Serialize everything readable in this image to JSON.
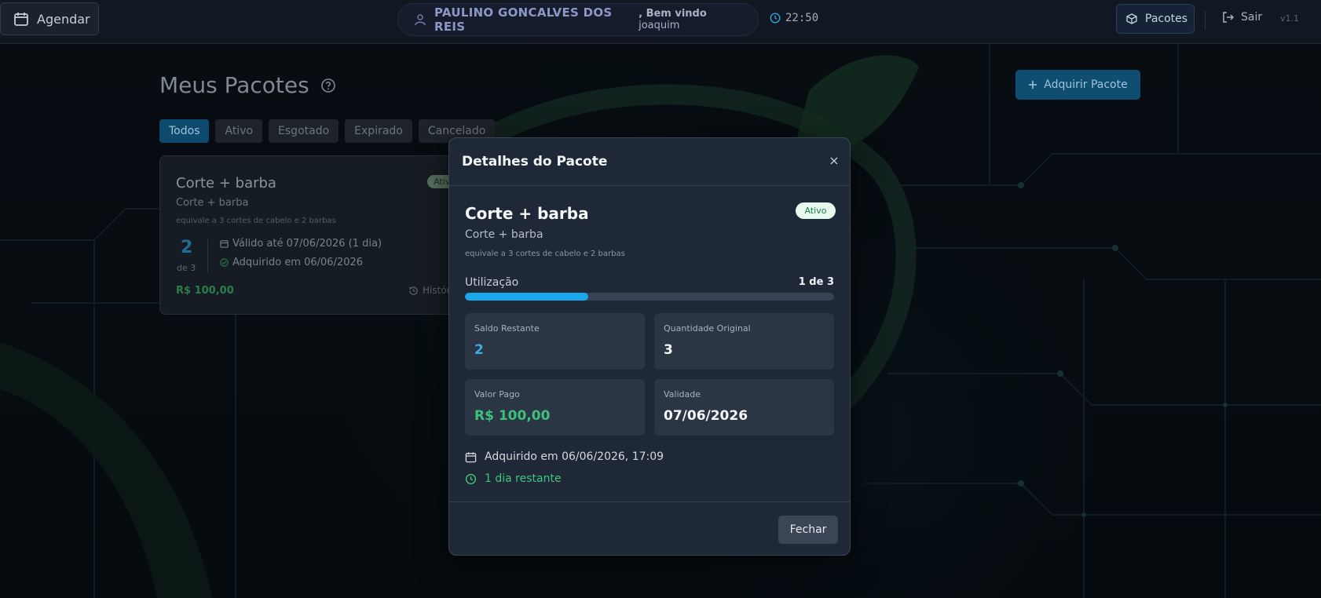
{
  "navbar": {
    "agendar_label": "Agendar",
    "user_name": "PAULINO GONCALVES DOS REIS",
    "welcome_prefix": ", Bem vindo",
    "welcome_user": "joaquim",
    "clock": "22:50",
    "pacotes_label": "Pacotes",
    "logout_label": "Sair",
    "version": "v1.1"
  },
  "page": {
    "title": "Meus Pacotes",
    "add_button": "Adquirir Pacote",
    "filters": [
      "Todos",
      "Ativo",
      "Esgotado",
      "Expirado",
      "Cancelado"
    ],
    "active_filter": "Todos"
  },
  "card": {
    "title": "Corte + barba",
    "subtitle": "Corte + barba",
    "description": "equivale a 3 cortes de cabelo e 2 barbas",
    "badge": "Ativo",
    "remaining": "2",
    "of_total": "de 3",
    "valid_until": "Válido até 07/06/2026 (1 dia)",
    "acquired": "Adquirido em 06/06/2026",
    "price": "R$ 100,00",
    "history_label": "Histórico"
  },
  "modal": {
    "title": "Detalhes do Pacote",
    "close_symbol": "×",
    "package_name": "Corte + barba",
    "status": "Ativo",
    "subtitle": "Corte + barba",
    "description": "equivale a 3 cortes de cabelo e 2 barbas",
    "usage_label": "Utilização",
    "usage_value": "1 de 3",
    "usage_fraction": 0.3333,
    "boxes": {
      "saldo_label": "Saldo Restante",
      "saldo_value": "2",
      "original_label": "Quantidade Original",
      "original_value": "3",
      "pago_label": "Valor Pago",
      "pago_value": "R$ 100,00",
      "validade_label": "Validade",
      "validade_value": "07/06/2026"
    },
    "acquired_line": "Adquirido em 06/06/2026, 17:09",
    "remaining_line": "1 dia restante",
    "close_button": "Fechar"
  },
  "colors": {
    "accent": "#1aa7ea",
    "success": "#40c57f",
    "modal_bg": "#1e2837"
  },
  "icons": [
    "calendar-icon",
    "user-icon",
    "clock-icon",
    "box-icon",
    "logout-icon",
    "help-icon",
    "plus-icon",
    "check-circle-icon",
    "history-icon",
    "close-icon"
  ]
}
